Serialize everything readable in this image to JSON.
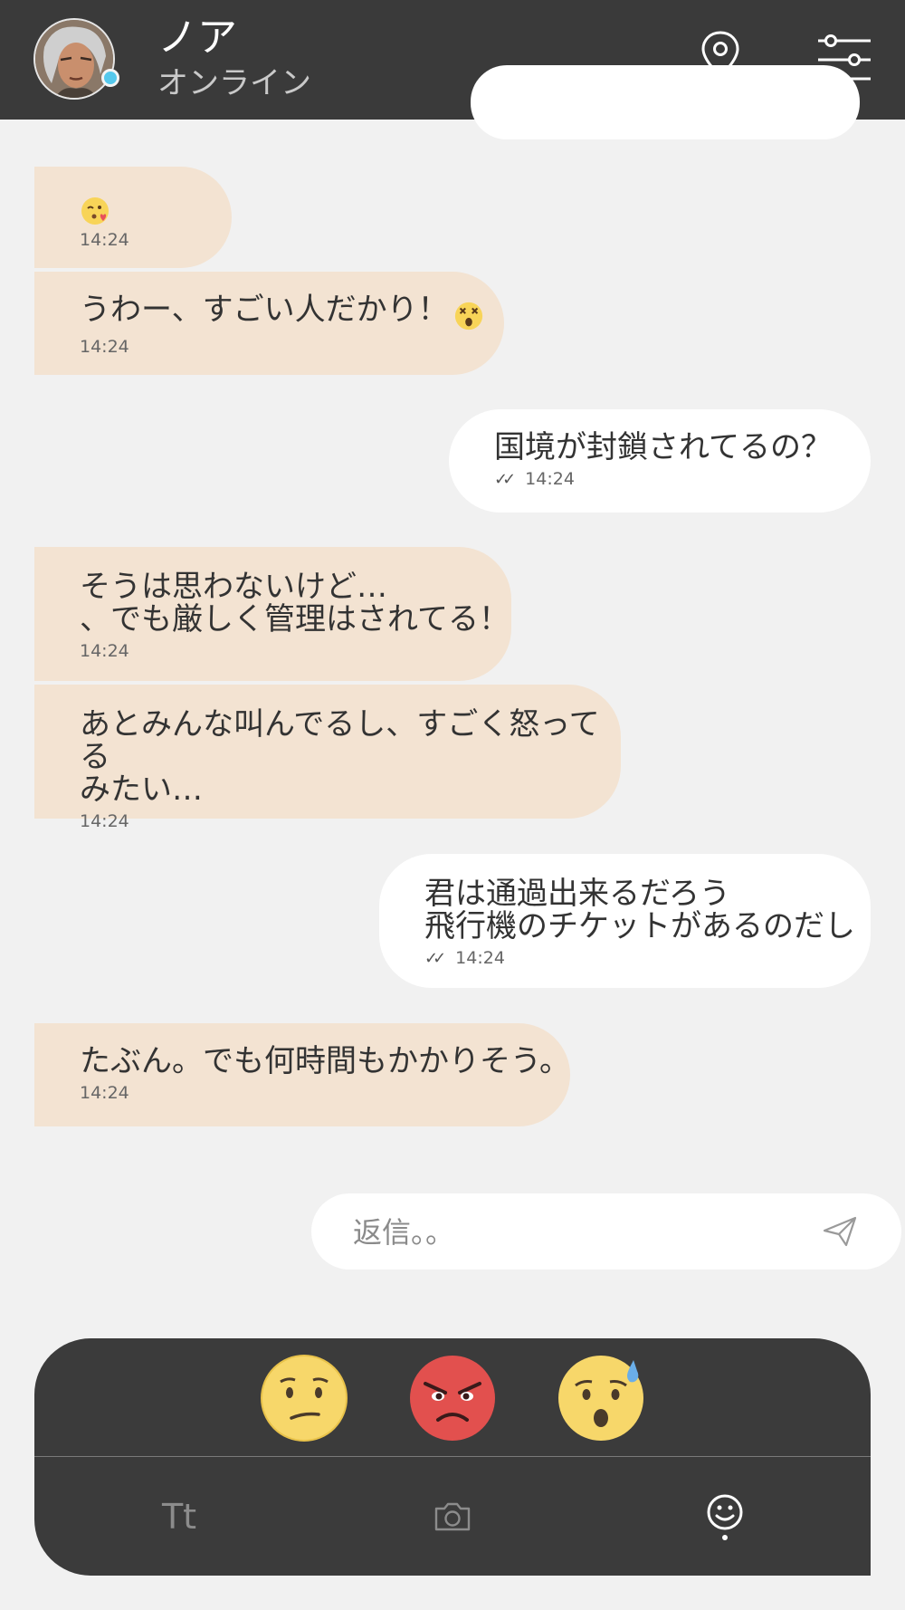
{
  "header": {
    "contact_name": "ノア",
    "contact_status": "オンライン",
    "avatar_icon": "person-avatar",
    "online_color": "#55c8ec",
    "actions": [
      {
        "icon": "location-pin-icon"
      },
      {
        "icon": "filter-sliders-icon"
      }
    ]
  },
  "messages": [
    {
      "direction": "incoming",
      "text": "",
      "emoji": "kissing-heart-emoji",
      "time": "14:24"
    },
    {
      "direction": "incoming",
      "text": "うわー、すごい人だかり！",
      "emoji": "dizzy-face-emoji",
      "time": "14:24"
    },
    {
      "direction": "outgoing",
      "text": "国境が封鎖されてるの？",
      "time": "14:24",
      "read": true
    },
    {
      "direction": "incoming",
      "text": "そうは思わないけど…\n、でも厳しく管理はされてる！",
      "time": "14:24"
    },
    {
      "direction": "incoming",
      "text": "あとみんな叫んでるし、すごく怒ってる\nみたい…",
      "time": "14:24"
    },
    {
      "direction": "outgoing",
      "text": "君は通過出来るだろう\n飛行機のチケットがあるのだし",
      "time": "14:24",
      "read": true
    },
    {
      "direction": "incoming",
      "text": "たぶん。でも何時間もかかりそう。",
      "time": "14:24"
    }
  ],
  "reply": {
    "placeholder": "返信。。",
    "send_icon": "paper-plane-icon"
  },
  "emoji_picker": {
    "options": [
      "confused-face-emoji",
      "angry-face-emoji",
      "anxious-sweat-face-emoji"
    ]
  },
  "bottom_tabs": [
    {
      "label": "Tt",
      "name": "text-format"
    },
    {
      "icon": "camera-icon"
    },
    {
      "icon": "smiley-icon",
      "active": true
    }
  ],
  "colors": {
    "header_bg": "#3a3a3a",
    "incoming_bubble": "#f3e3d2",
    "outgoing_bubble": "#ffffff",
    "panel_bg": "#3b3b3b"
  }
}
